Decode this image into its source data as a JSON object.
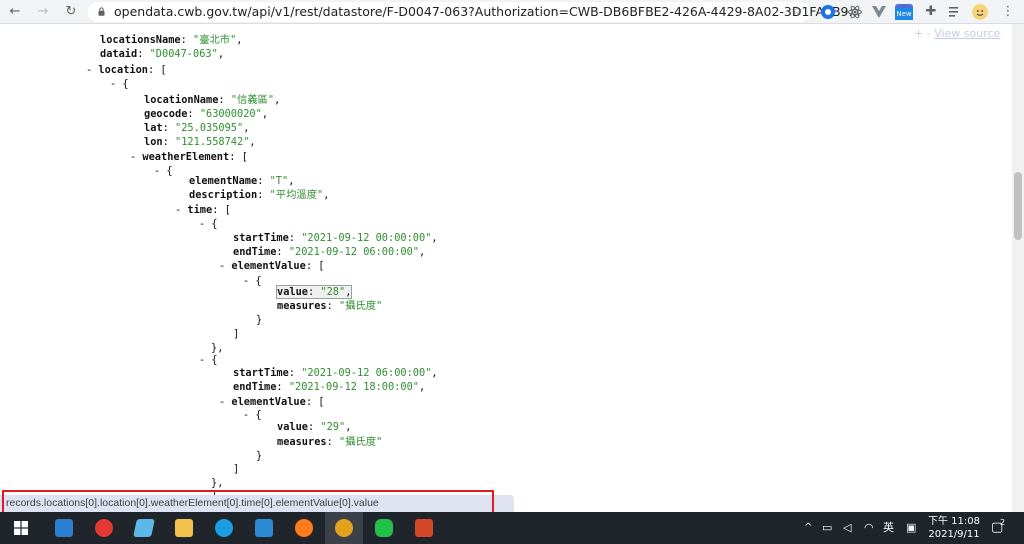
{
  "browser": {
    "url": "opendata.cwb.gov.tw/api/v1/rest/datastore/F-D0047-063?Authorization=CWB-DB6BFBE2-426A-4429-8A02-3D1FA5B9...",
    "extension_badge": "New"
  },
  "viewer": {
    "view_source_prefix": "+ - ",
    "view_source_label": "View source"
  },
  "json_lines": [
    {
      "id": "l0",
      "t": "s",
      "key": "locationsName",
      "val": "\"臺北市\""
    },
    {
      "id": "l1",
      "t": "s",
      "key": "dataid",
      "val": "\"D0047-063\""
    },
    {
      "id": "l2",
      "t": "o",
      "key": "location",
      "open": "["
    },
    {
      "id": "l3",
      "t": "b",
      "text": "{"
    },
    {
      "id": "l4",
      "t": "s",
      "key": "locationName",
      "val": "\"信義區\""
    },
    {
      "id": "l5",
      "t": "s",
      "key": "geocode",
      "val": "\"63000020\""
    },
    {
      "id": "l6",
      "t": "s",
      "key": "lat",
      "val": "\"25.035095\""
    },
    {
      "id": "l7",
      "t": "s",
      "key": "lon",
      "val": "\"121.558742\""
    },
    {
      "id": "l8",
      "t": "o",
      "key": "weatherElement",
      "open": "["
    },
    {
      "id": "l9",
      "t": "b",
      "text": "{"
    },
    {
      "id": "l10",
      "t": "s",
      "key": "elementName",
      "val": "\"T\""
    },
    {
      "id": "l11",
      "t": "s",
      "key": "description",
      "val": "\"平均溫度\""
    },
    {
      "id": "l12",
      "t": "o",
      "key": "time",
      "open": "["
    },
    {
      "id": "l13",
      "t": "b",
      "text": "{"
    },
    {
      "id": "l14",
      "t": "s",
      "key": "startTime",
      "val": "\"2021-09-12 00:00:00\""
    },
    {
      "id": "l15",
      "t": "s",
      "key": "endTime",
      "val": "\"2021-09-12 06:00:00\""
    },
    {
      "id": "l16",
      "t": "o",
      "key": "elementValue",
      "open": "["
    },
    {
      "id": "l17",
      "t": "b",
      "text": "{"
    },
    {
      "id": "l18",
      "t": "s",
      "key": "value",
      "val": "\"28\"",
      "highlight": true
    },
    {
      "id": "l19",
      "t": "s",
      "key": "measures",
      "val": "\"攝氏度\"",
      "last": true
    },
    {
      "id": "l20",
      "t": "c",
      "text": "}"
    },
    {
      "id": "l21",
      "t": "c",
      "text": "]"
    },
    {
      "id": "l22",
      "t": "c",
      "text": "},"
    },
    {
      "id": "l23",
      "t": "b",
      "text": "{"
    },
    {
      "id": "l24",
      "t": "s",
      "key": "startTime",
      "val": "\"2021-09-12 06:00:00\""
    },
    {
      "id": "l25",
      "t": "s",
      "key": "endTime",
      "val": "\"2021-09-12 18:00:00\""
    },
    {
      "id": "l26",
      "t": "o",
      "key": "elementValue",
      "open": "["
    },
    {
      "id": "l27",
      "t": "b",
      "text": "{"
    },
    {
      "id": "l28",
      "t": "s",
      "key": "value",
      "val": "\"29\""
    },
    {
      "id": "l29",
      "t": "s",
      "key": "measures",
      "val": "\"攝氏度\"",
      "last": true
    },
    {
      "id": "l30",
      "t": "c",
      "text": "}"
    },
    {
      "id": "l31",
      "t": "c",
      "text": "]"
    },
    {
      "id": "l32",
      "t": "c",
      "text": "},"
    },
    {
      "id": "l33",
      "t": "b",
      "text": "{"
    }
  ],
  "status_bar": {
    "text": "records.locations[0].location[0].weatherElement[0].time[0].elementValue[0].value"
  },
  "taskbar": {
    "ime_label": "英",
    "time": "下午 11:08",
    "date": "2021/9/11",
    "notification_count": "2"
  },
  "colors": {
    "json_key": "#111111",
    "json_string": "#2f8f2f",
    "status_highlight_border": "#e01b24",
    "taskbar_bg": "#20242b"
  }
}
